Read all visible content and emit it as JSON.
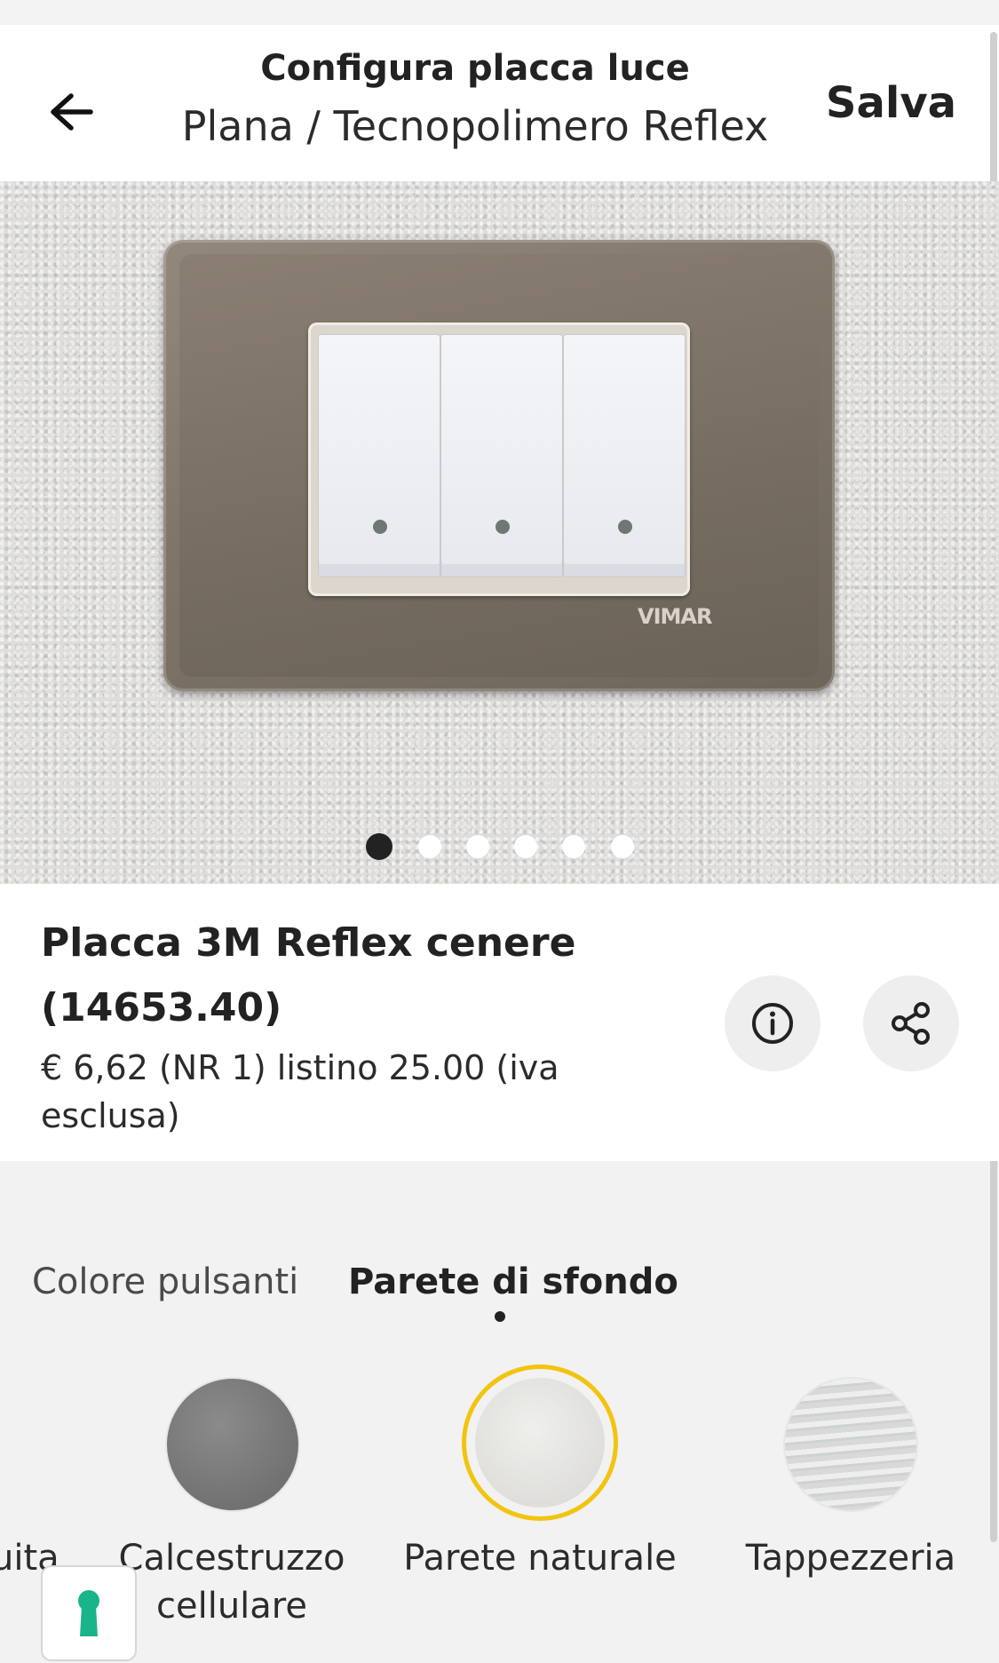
{
  "header": {
    "title": "Configura placca luce",
    "subtitle": "Plana / Tecnopolimero Reflex",
    "save_label": "Salva",
    "back_icon": "arrow-left-icon"
  },
  "preview": {
    "brand_text": "VIMAR",
    "carousel": {
      "total": 6,
      "active_index": 0
    }
  },
  "product": {
    "name": "Placca 3M Reflex cenere (14653.40)",
    "price": "€ 6,62 (NR 1) listino 25.00 (iva esclusa)",
    "info_icon": "info-icon",
    "share_icon": "share-icon"
  },
  "tabs": [
    {
      "label": "Colore pulsanti",
      "active": false
    },
    {
      "label": "Parete di sfondo",
      "active": true
    }
  ],
  "walls": [
    {
      "label": "uita",
      "selected": false
    },
    {
      "label": "Calcestruzzo cellulare",
      "selected": false
    },
    {
      "label": "Parete naturale",
      "selected": true
    },
    {
      "label": "Tappezzeria",
      "selected": false
    }
  ],
  "colors": {
    "selected_ring": "#f2c40f",
    "lock_icon": "#19b48a"
  },
  "floating": {
    "lock_icon": "keyhole-icon"
  }
}
